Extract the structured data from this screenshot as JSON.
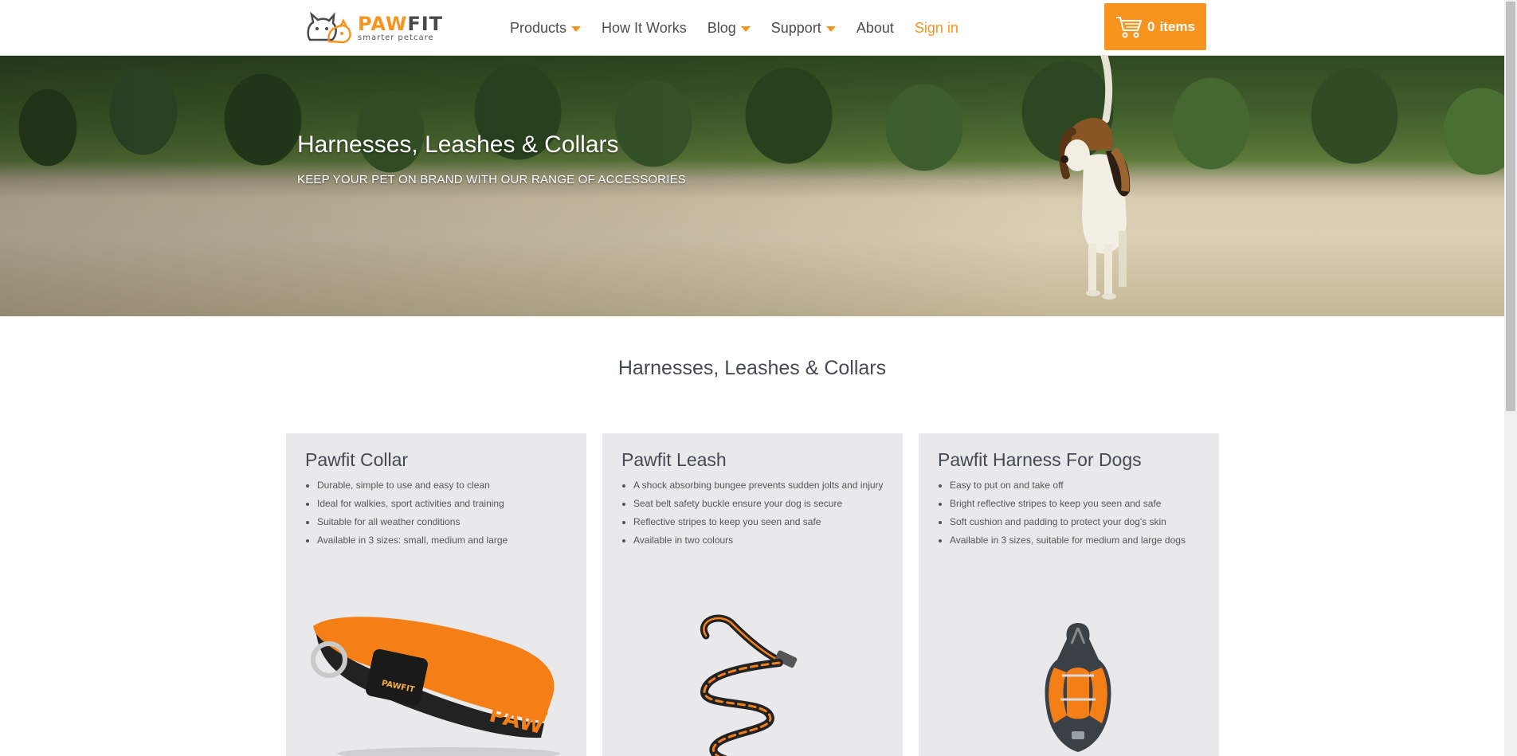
{
  "brand": {
    "name_part1": "PAW",
    "name_part2": "FIT",
    "tagline": "smarter petcare",
    "accent": "#f7941d"
  },
  "nav": {
    "items": [
      {
        "label": "Products",
        "has_dropdown": true
      },
      {
        "label": "How It Works",
        "has_dropdown": false
      },
      {
        "label": "Blog",
        "has_dropdown": true
      },
      {
        "label": "Support",
        "has_dropdown": true
      },
      {
        "label": "About",
        "has_dropdown": false
      },
      {
        "label": "Sign in",
        "has_dropdown": false
      }
    ]
  },
  "cart": {
    "count": "0",
    "label": "items",
    "icon": "cart-icon"
  },
  "hero": {
    "title": "Harnesses, Leashes & Collars",
    "subtitle": "KEEP YOUR PET ON BRAND WITH OUR RANGE OF ACCESSORIES"
  },
  "section": {
    "title": "Harnesses, Leashes & Collars"
  },
  "products": [
    {
      "name": "Pawfit Collar",
      "features": [
        "Durable, simple to use and easy to clean",
        "Ideal for walkies, sport activities and training",
        "Suitable for all weather conditions",
        "Available in 3 sizes: small, medium and large"
      ]
    },
    {
      "name": "Pawfit Leash",
      "features": [
        "A shock absorbing bungee prevents sudden jolts and injury",
        "Seat belt safety buckle ensure your dog is secure",
        "Reflective stripes to keep you seen and safe",
        "Available in two colours"
      ]
    },
    {
      "name": "Pawfit Harness For Dogs",
      "features": [
        "Easy to put on and take off",
        "Bright reflective stripes to keep you seen and safe",
        "Soft cushion and padding to protect your dog's skin",
        "Available in 3 sizes, suitable for medium and large dogs"
      ]
    }
  ],
  "collar_print": "PAW"
}
